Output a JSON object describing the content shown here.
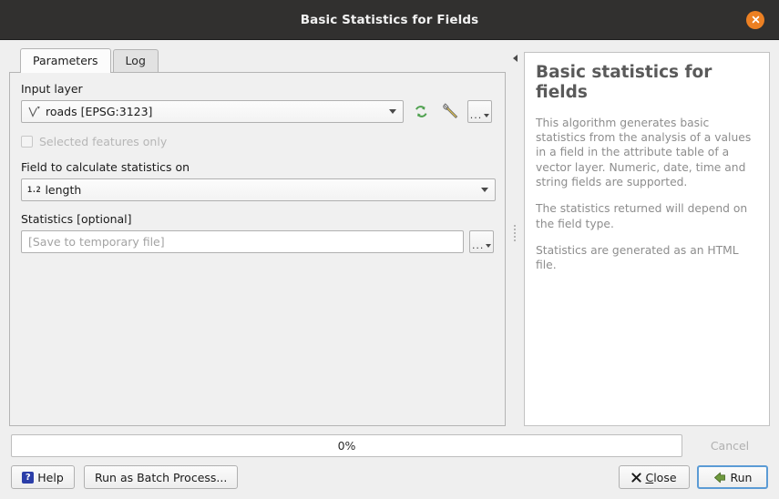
{
  "window": {
    "title": "Basic Statistics for Fields",
    "close_icon": "close-circle-icon"
  },
  "tabs": [
    {
      "label": "Parameters",
      "active": true
    },
    {
      "label": "Log",
      "active": false
    }
  ],
  "parameters": {
    "input_layer": {
      "label": "Input layer",
      "value": "roads [EPSG:3123]",
      "layer_icon": "line-vector-layer-icon",
      "iterate_icon": "iterate-refresh-icon",
      "advanced_icon": "wrench-icon",
      "browse_label": "..."
    },
    "selected_features_only": {
      "label": "Selected features only",
      "checked": false,
      "enabled": false
    },
    "field": {
      "label": "Field to calculate statistics on",
      "value": "length",
      "type_icon": "1.2"
    },
    "statistics_output": {
      "label": "Statistics [optional]",
      "placeholder": "[Save to temporary file]",
      "value": "",
      "browse_label": "..."
    }
  },
  "help": {
    "title": "Basic statistics for fields",
    "paragraphs": [
      "This algorithm generates basic statistics from the analysis of a values in a field in the attribute table of a vector layer. Numeric, date, time and string fields are supported.",
      "The statistics returned will depend on the field type.",
      "Statistics are generated as an HTML file."
    ],
    "collapse_icon": "collapse-left-arrow-icon"
  },
  "footer": {
    "progress": "0%",
    "progress_value": 0,
    "cancel_label": "Cancel",
    "help_label": "Help",
    "help_icon": "question-mark-icon",
    "batch_label": "Run as Batch Process...",
    "close_label": "Close",
    "close_icon": "x-icon",
    "run_label": "Run",
    "run_icon": "green-arrow-icon"
  },
  "colors": {
    "titlebar": "#31302f",
    "close_button": "#ec8023",
    "accent_focus": "#5b9bd5",
    "panel_bg": "#efefef",
    "help_bg": "#ffffff"
  }
}
